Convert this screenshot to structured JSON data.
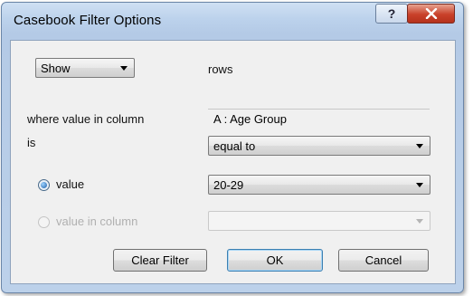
{
  "dialog": {
    "title": "Casebook Filter Options",
    "help_glyph": "?",
    "close_glyph": "X"
  },
  "action": {
    "selected": "Show",
    "suffix": "rows"
  },
  "column": {
    "label": "where value in column",
    "value": "A : Age Group"
  },
  "operator": {
    "label": "is",
    "selected": "equal to"
  },
  "value_option": {
    "label": "value",
    "selected": "20-29",
    "checked": true
  },
  "value_in_column_option": {
    "label": "value in column",
    "selected": "",
    "enabled": false
  },
  "buttons": {
    "clear": "Clear Filter",
    "ok": "OK",
    "cancel": "Cancel"
  }
}
